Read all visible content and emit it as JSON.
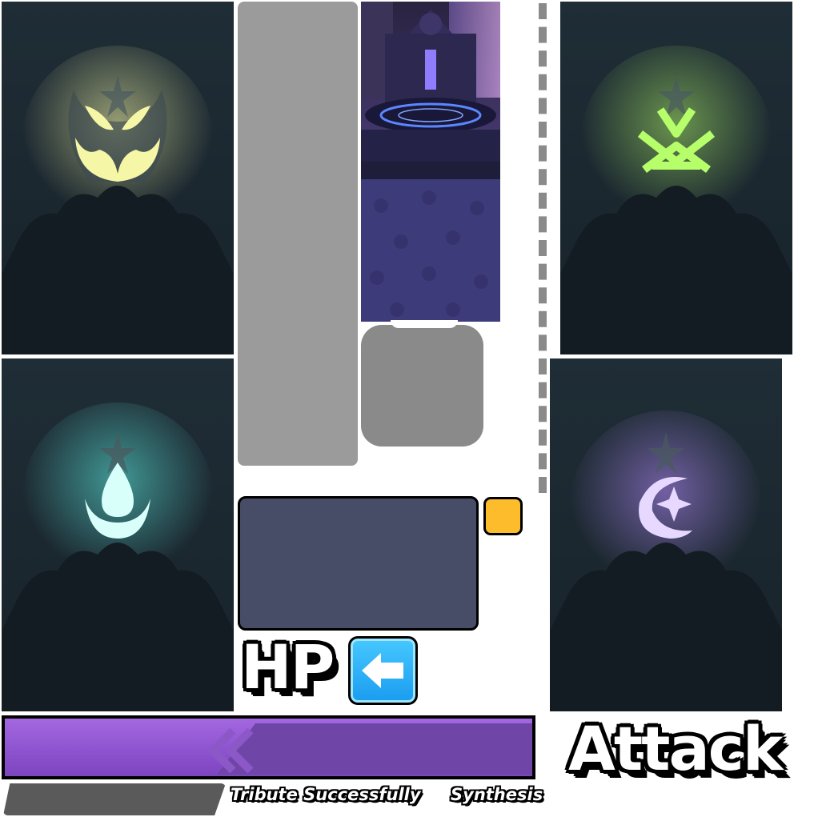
{
  "labels": {
    "hp": "HP",
    "attack": "Attack",
    "tribute": "Tribute Successfully",
    "synthesis": "Synthesis"
  },
  "icons": {
    "card_yellow": "butterfly-emblem-icon",
    "card_green": "rune-emblem-icon",
    "card_cyan": "water-drop-moon-emblem-icon",
    "card_purple": "crescent-star-emblem-icon",
    "back_button": "arrow-left-icon"
  },
  "colors": {
    "yellow_glow": "#f6f7a6",
    "green_glow": "#b7ff6a",
    "cyan_glow": "#5ff2e6",
    "purple_glow": "#e6d8ff",
    "bar_purple": "#9b5fdc",
    "back_button": "#2eb4ff",
    "highlight_square": "#fdbc2c",
    "panel_dark": "#474d66"
  }
}
